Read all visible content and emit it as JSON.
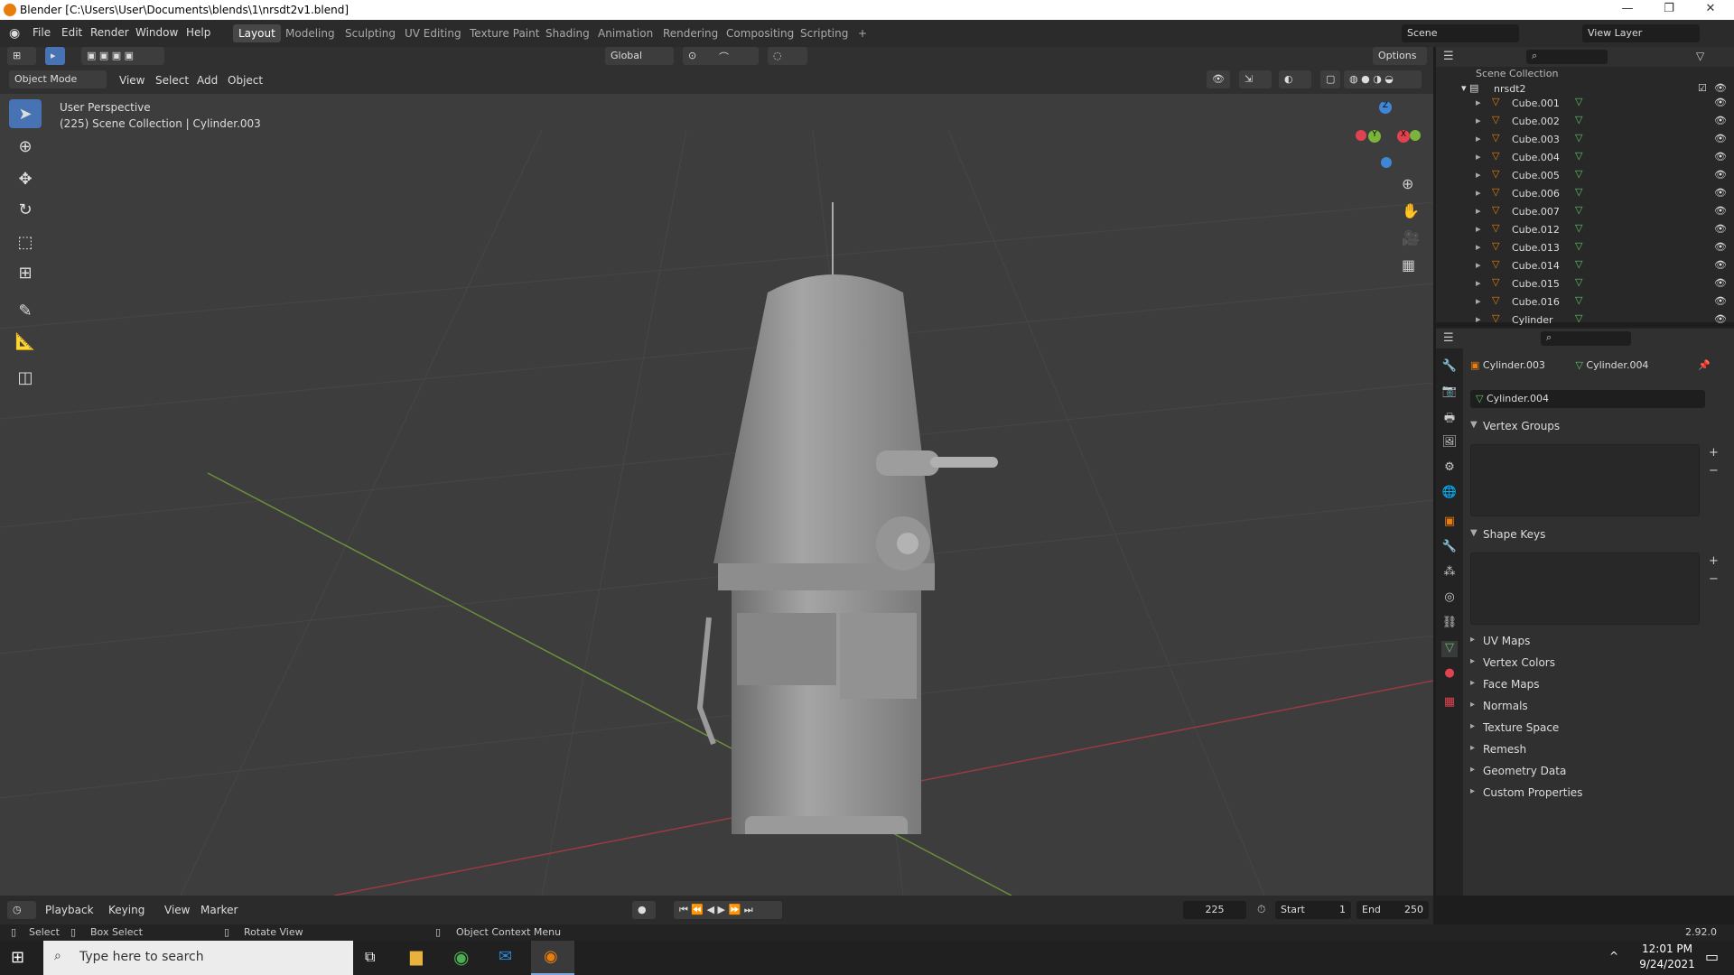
{
  "window": {
    "title": "Blender [C:\\Users\\User\\Documents\\blends\\1\\nrsdt2v1.blend]",
    "minimize": "—",
    "restore": "❐",
    "close": "✕"
  },
  "menu": [
    "File",
    "Edit",
    "Render",
    "Window",
    "Help"
  ],
  "workspaces": [
    "Layout",
    "Modeling",
    "Sculpting",
    "UV Editing",
    "Texture Paint",
    "Shading",
    "Animation",
    "Rendering",
    "Compositing",
    "Scripting",
    "+"
  ],
  "scene": {
    "label": "Scene",
    "view_layer": "View Layer"
  },
  "header": {
    "mode": "Object Mode",
    "view": "View",
    "select": "Select",
    "add": "Add",
    "object": "Object",
    "transform": "Global",
    "options": "Options"
  },
  "viewport": {
    "perspective": "User Perspective",
    "context": "(225) Scene Collection | Cylinder.003",
    "gizmo": {
      "z": "Z",
      "y": "Y",
      "x": "X"
    }
  },
  "outliner": {
    "root": "Scene Collection",
    "collection": "nrsdt2",
    "items": [
      "Cube.001",
      "Cube.002",
      "Cube.003",
      "Cube.004",
      "Cube.005",
      "Cube.006",
      "Cube.007",
      "Cube.012",
      "Cube.013",
      "Cube.014",
      "Cube.015",
      "Cube.016",
      "Cylinder"
    ]
  },
  "properties": {
    "object": "Cylinder.003",
    "mesh": "Cylinder.004",
    "datablock": "Cylinder.004",
    "sections": {
      "vertex_groups": "Vertex Groups",
      "shape_keys": "Shape Keys"
    },
    "collapsed": [
      "UV Maps",
      "Vertex Colors",
      "Face Maps",
      "Normals",
      "Texture Space",
      "Remesh",
      "Geometry Data",
      "Custom Properties"
    ]
  },
  "timeline": {
    "playback": "Playback",
    "keying": "Keying",
    "view": "View",
    "marker": "Marker",
    "frame": "225",
    "start_label": "Start",
    "start": "1",
    "end_label": "End",
    "end": "250"
  },
  "status": {
    "select": "Select",
    "box_select": "Box Select",
    "rotate": "Rotate View",
    "context_menu": "Object Context Menu",
    "version": "2.92.0"
  },
  "taskbar": {
    "search": "Type here to search",
    "time": "12:01 PM",
    "date": "9/24/2021"
  },
  "colors": {
    "accent": "#4772b3",
    "x_axis": "#e0424f",
    "y_axis": "#7bb43c",
    "z_axis": "#3f86d6",
    "object_orange": "#e87d0d",
    "mesh_green": "#5ec46a"
  }
}
